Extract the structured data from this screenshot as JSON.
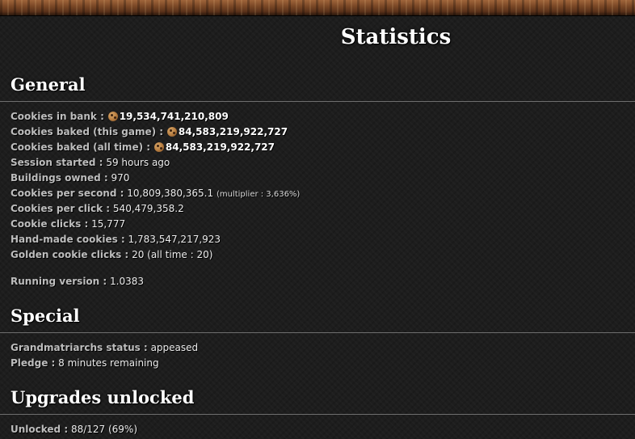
{
  "title": "Statistics",
  "general": {
    "heading": "General",
    "cookies_in_bank": {
      "label": "Cookies in bank :",
      "value": "19,534,741,210,809"
    },
    "baked_this_game": {
      "label": "Cookies baked (this game) :",
      "value": "84,583,219,922,727"
    },
    "baked_all_time": {
      "label": "Cookies baked (all time) :",
      "value": "84,583,219,922,727"
    },
    "session_started": {
      "label": "Session started :",
      "value": "59 hours ago"
    },
    "buildings_owned": {
      "label": "Buildings owned :",
      "value": "970"
    },
    "cookies_per_second": {
      "label": "Cookies per second :",
      "value": "10,809,380,365.1",
      "multiplier": "(multiplier : 3,636%)"
    },
    "cookies_per_click": {
      "label": "Cookies per click :",
      "value": "540,479,358.2"
    },
    "cookie_clicks": {
      "label": "Cookie clicks :",
      "value": "15,777"
    },
    "hand_made": {
      "label": "Hand-made cookies :",
      "value": "1,783,547,217,923"
    },
    "golden_clicks": {
      "label": "Golden cookie clicks :",
      "value": "20 (all time : 20)"
    },
    "running_version": {
      "label": "Running version :",
      "value": "1.0383"
    }
  },
  "special": {
    "heading": "Special",
    "grandmatriarchs": {
      "label": "Grandmatriarchs status :",
      "value": "appeased"
    },
    "pledge": {
      "label": "Pledge :",
      "value": "8 minutes remaining"
    }
  },
  "upgrades": {
    "heading": "Upgrades unlocked",
    "unlocked": {
      "label": "Unlocked :",
      "value": "88/127 (69%)"
    }
  },
  "icons": {
    "cookie": "cookie-icon"
  }
}
